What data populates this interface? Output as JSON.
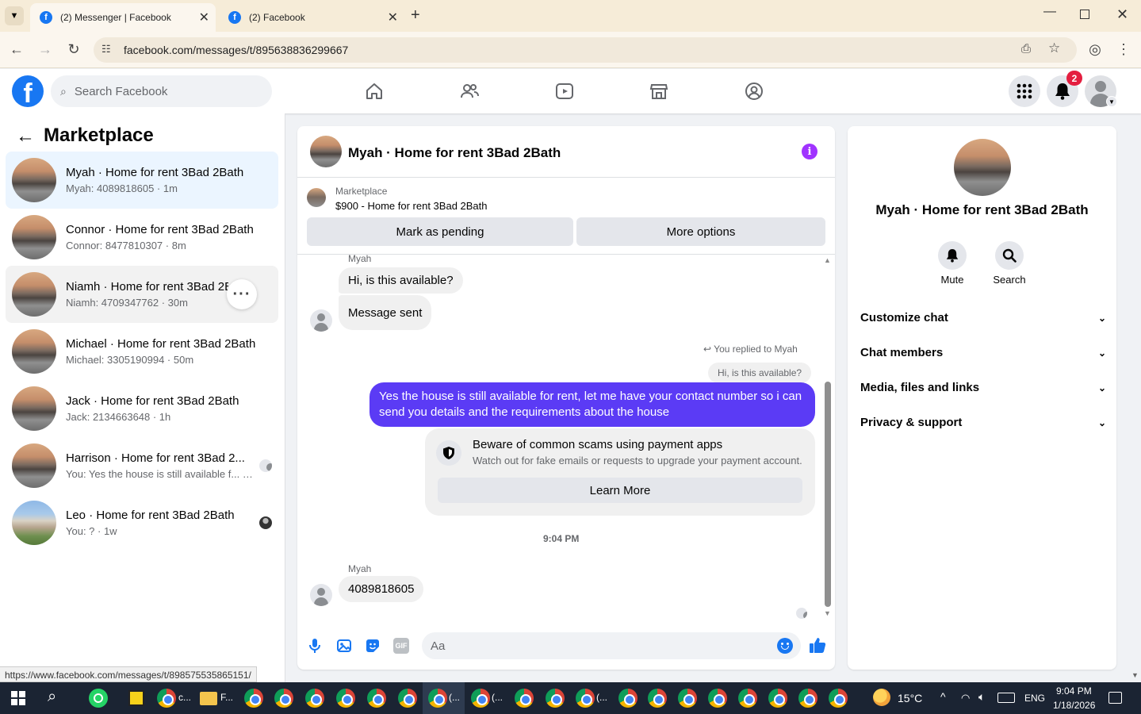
{
  "browser": {
    "tabs": [
      {
        "title": "(2) Messenger | Facebook",
        "active": true
      },
      {
        "title": "(2) Facebook",
        "active": false
      }
    ],
    "url": "facebook.com/messages/t/895638836299667",
    "status_url": "https://www.facebook.com/messages/t/898575535865151/"
  },
  "fb": {
    "search_placeholder": "Search Facebook",
    "notification_count": "2"
  },
  "sidebar": {
    "title": "Marketplace",
    "conversations": [
      {
        "name": "Myah · Home for rent 3Bad 2Bath",
        "preview": "Myah: 4089818605 · 1m"
      },
      {
        "name": "Connor · Home for rent 3Bad 2Bath",
        "preview": "Connor: 8477810307 · 8m"
      },
      {
        "name": "Niamh · Home for rent 3Bad 2Bath",
        "preview": "Niamh: 4709347762 · 30m"
      },
      {
        "name": "Michael · Home for rent 3Bad 2Bath",
        "preview": "Michael: 3305190994 · 50m"
      },
      {
        "name": "Jack · Home for rent 3Bad 2Bath",
        "preview": "Jack: 2134663648 · 1h"
      },
      {
        "name": "Harrison · Home for rent 3Bad 2...",
        "preview": "You: Yes the house is still available f... · 1h"
      },
      {
        "name": "Leo · Home for rent 3Bad 2Bath",
        "preview": "You: ? · 1w"
      }
    ]
  },
  "chat": {
    "title": "Myah · Home for rent 3Bad 2Bath",
    "listing_source": "Marketplace",
    "listing": "$900 - Home for rent 3Bad 2Bath",
    "mark_pending": "Mark as pending",
    "more_options": "More options",
    "sender1": "Myah",
    "msg1": "Hi, is this available?",
    "msg2": "Message sent",
    "replied_to": "You replied to Myah",
    "quoted": "Hi, is this available?",
    "outgoing": "Yes the house is still available for rent, let me have your contact number so i can send you details and the requirements about the house",
    "scam_title": "Beware of common scams using payment apps",
    "scam_body": "Watch out for fake emails or requests to upgrade your payment account.",
    "learn_more": "Learn More",
    "timestamp": "9:04 PM",
    "sender2": "Myah",
    "msg3": "4089818605",
    "composer_placeholder": "Aa"
  },
  "info": {
    "name": "Myah · Home for rent 3Bad 2Bath",
    "mute": "Mute",
    "search": "Search",
    "sections": [
      "Customize chat",
      "Chat members",
      "Media, files and links",
      "Privacy & support"
    ]
  },
  "taskbar": {
    "weather": "15°C",
    "lang": "ENG",
    "time": "9:04 PM",
    "date": "1/18/2026",
    "label_c": "c...",
    "label_f": "F...",
    "label_paren1": "(...",
    "label_paren2": "(...",
    "label_paren3": "(..."
  },
  "colors": {
    "fb_blue": "#1877f2",
    "outgoing_bubble": "#5b3bf5",
    "accent_purple": "#a033ff"
  }
}
